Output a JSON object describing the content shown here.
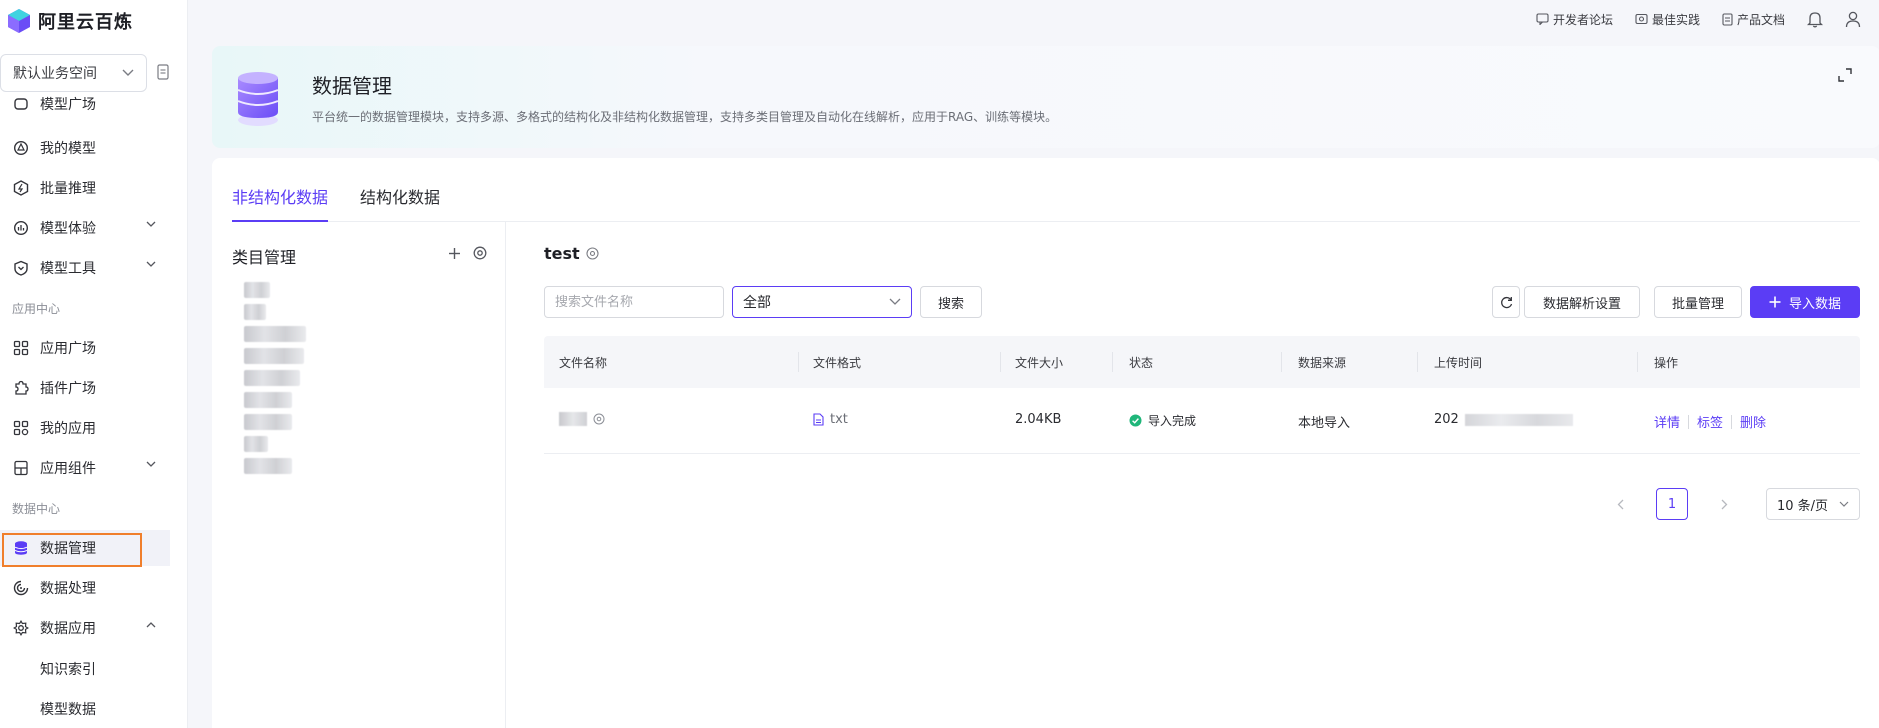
{
  "app": {
    "name": "阿里云百炼"
  },
  "workspace": {
    "label": "默认业务空间"
  },
  "topbar": {
    "links": [
      {
        "label": "开发者论坛",
        "icon": "forum-icon"
      },
      {
        "label": "最佳实践",
        "icon": "practice-icon"
      },
      {
        "label": "产品文档",
        "icon": "doc-icon"
      }
    ]
  },
  "sidebar": {
    "items": [
      {
        "label": "模型广场",
        "icon": "model-square-icon"
      },
      {
        "label": "我的模型",
        "icon": "my-model-icon"
      },
      {
        "label": "批量推理",
        "icon": "batch-inference-icon"
      },
      {
        "label": "模型体验",
        "icon": "model-experience-icon"
      },
      {
        "label": "模型工具",
        "icon": "model-tools-icon"
      },
      {
        "label": "应用中心"
      },
      {
        "label": "应用广场",
        "icon": "app-square-icon"
      },
      {
        "label": "插件广场",
        "icon": "plugin-icon"
      },
      {
        "label": "我的应用",
        "icon": "my-app-icon"
      },
      {
        "label": "应用组件",
        "icon": "app-component-icon"
      },
      {
        "label": "数据中心"
      },
      {
        "label": "数据管理",
        "icon": "database-icon"
      },
      {
        "label": "数据处理",
        "icon": "data-process-icon"
      },
      {
        "label": "数据应用",
        "icon": "data-app-icon"
      },
      {
        "label": "知识索引"
      },
      {
        "label": "模型数据"
      }
    ]
  },
  "header": {
    "title": "数据管理",
    "description": "平台统一的数据管理模块，支持多源、多格式的结构化及非结构化数据管理，支持多类目管理及自动化在线解析，应用于RAG、训练等模块。"
  },
  "tabs": [
    {
      "label": "非结构化数据"
    },
    {
      "label": "结构化数据"
    }
  ],
  "category": {
    "title": "类目管理"
  },
  "main": {
    "title": "test",
    "search_placeholder": "搜索文件名称",
    "filter_value": "全部",
    "search_button": "搜索",
    "parse_settings": "数据解析设置",
    "batch_manage": "批量管理",
    "import_data": "导入数据"
  },
  "table": {
    "columns": [
      "文件名称",
      "文件格式",
      "文件大小",
      "状态",
      "数据来源",
      "上传时间",
      "操作"
    ],
    "rows": [
      {
        "format": "txt",
        "size": "2.04KB",
        "status": "导入完成",
        "source": "本地导入",
        "time": "202",
        "ops": [
          "详情",
          "标签",
          "删除"
        ]
      }
    ]
  },
  "pagination": {
    "current": "1",
    "page_size": "10 条/页"
  },
  "colors": {
    "accent": "#5b3df5",
    "success": "#1fb67a",
    "highlight": "#f07f2c"
  }
}
